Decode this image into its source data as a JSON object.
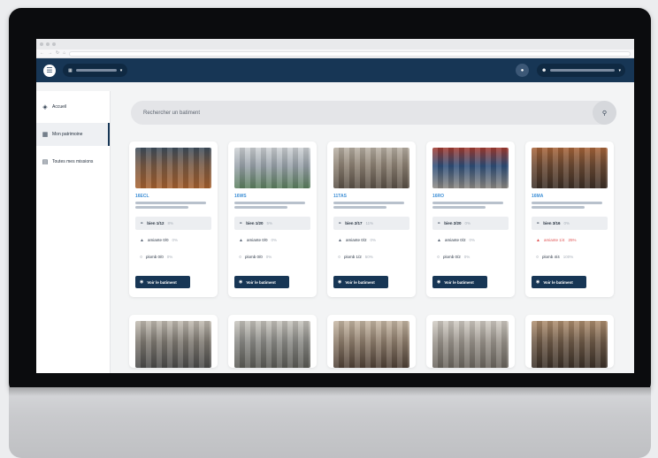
{
  "header": {
    "menu_icon": "menu-icon",
    "agency_icon": "building-icon",
    "bell_icon": "bell-icon",
    "account_icon": "user-icon"
  },
  "sidebar": {
    "items": [
      {
        "label": "Accueil",
        "icon": "compass-icon"
      },
      {
        "label": "Mon patrimoine",
        "icon": "building-icon"
      },
      {
        "label": "Toutes mes missions",
        "icon": "list-icon"
      }
    ]
  },
  "search": {
    "placeholder": "Rechercher un batiment",
    "icon": "search-icon"
  },
  "cards": [
    {
      "ref": "16ECL",
      "stats": [
        {
          "label": "bien 1/12",
          "pct": "8%",
          "icon": "link-icon"
        },
        {
          "label": "amiante 0/0",
          "pct": "0%",
          "icon": "warning-icon"
        },
        {
          "label": "plomb 0/0",
          "pct": "0%",
          "icon": "drop-icon"
        }
      ],
      "button": "Voir le batiment",
      "photo": [
        "#7a5a44",
        "#3e4d5c",
        "#a8622f"
      ]
    },
    {
      "ref": "16WS",
      "stats": [
        {
          "label": "bien 1/20",
          "pct": "5%",
          "icon": "link-icon"
        },
        {
          "label": "amiante 0/0",
          "pct": "0%",
          "icon": "warning-icon"
        },
        {
          "label": "plomb 0/0",
          "pct": "0%",
          "icon": "drop-icon"
        }
      ],
      "button": "Voir le batiment",
      "photo": [
        "#9aa3ab",
        "#cfd3d6",
        "#5b7f5e"
      ]
    },
    {
      "ref": "11TAS",
      "stats": [
        {
          "label": "bien 2/17",
          "pct": "11%",
          "icon": "link-icon"
        },
        {
          "label": "amiante 0/2",
          "pct": "0%",
          "icon": "warning-icon"
        },
        {
          "label": "plomb 1/2",
          "pct": "50%",
          "icon": "drop-icon"
        }
      ],
      "button": "Voir le batiment",
      "photo": [
        "#8d8173",
        "#b9b1a5",
        "#5a5046"
      ]
    },
    {
      "ref": "16RO",
      "stats": [
        {
          "label": "bien 2/20",
          "pct": "0%",
          "icon": "link-icon"
        },
        {
          "label": "amiante 0/2",
          "pct": "0%",
          "icon": "warning-icon"
        },
        {
          "label": "plomb 0/2",
          "pct": "0%",
          "icon": "drop-icon"
        }
      ],
      "button": "Voir le batiment",
      "photo": [
        "#2f4f7a",
        "#a33a2f",
        "#8e8a84"
      ]
    },
    {
      "ref": "16MA",
      "stats": [
        {
          "label": "bien 3/16",
          "pct": "0%",
          "icon": "link-icon"
        },
        {
          "label": "amiante 1/4",
          "pct": "25%",
          "icon": "warning-icon",
          "alert": true
        },
        {
          "label": "plomb 4/4",
          "pct": "100%",
          "icon": "drop-icon"
        }
      ],
      "button": "Voir le batiment",
      "photo": [
        "#6b4a34",
        "#a8653a",
        "#3b2e26"
      ]
    }
  ],
  "row2_photos": [
    [
      "#7f7a72",
      "#c3bdb3",
      "#4a4a4a"
    ],
    [
      "#8a8a86",
      "#c9c6bf",
      "#5a5a55"
    ],
    [
      "#8e7d6c",
      "#c8b9a6",
      "#4e4036"
    ],
    [
      "#9a948c",
      "#d2cdc5",
      "#6a655e"
    ],
    [
      "#6e5a48",
      "#b09070",
      "#3a3028"
    ]
  ]
}
